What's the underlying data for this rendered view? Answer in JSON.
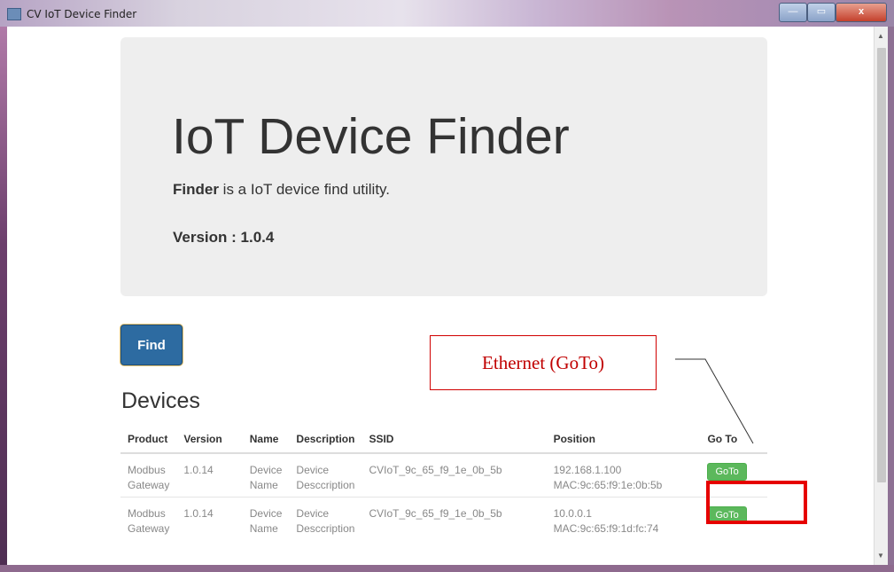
{
  "window": {
    "title": "CV IoT Device Finder",
    "icon": "app-icon",
    "buttons": {
      "minimize": "—",
      "maximize": "▭",
      "close": "x"
    }
  },
  "jumbotron": {
    "title": "IoT Device Finder",
    "desc_bold": "Finder",
    "desc_rest": " is a IoT device find utility.",
    "version": "Version : 1.0.4"
  },
  "find_button": "Find",
  "devices": {
    "heading": "Devices",
    "columns": [
      "Product",
      "Version",
      "Name",
      "Description",
      "SSID",
      "Position",
      "Go To"
    ],
    "rows": [
      {
        "product": "Modbus Gateway",
        "version": "1.0.14",
        "name": "Device Name",
        "description": "Device Desccription",
        "ssid": "CVIoT_9c_65_f9_1e_0b_5b",
        "ip": "192.168.1.100",
        "mac": "MAC:9c:65:f9:1e:0b:5b",
        "goto": "GoTo"
      },
      {
        "product": "Modbus Gateway",
        "version": "1.0.14",
        "name": "Device Name",
        "description": "Desccription",
        "description_first": "Device",
        "ssid": "CVIoT_9c_65_f9_1e_0b_5b",
        "ip": "10.0.0.1",
        "mac": "MAC:9c:65:f9:1d:fc:74",
        "goto": "GoTo"
      }
    ]
  },
  "annotation": {
    "label": "Ethernet (GoTo)",
    "color": "#d00000"
  },
  "colors": {
    "primary_button": "#2d6ba1",
    "success_button": "#5cb85c",
    "jumbotron_bg": "#eeeeee"
  }
}
